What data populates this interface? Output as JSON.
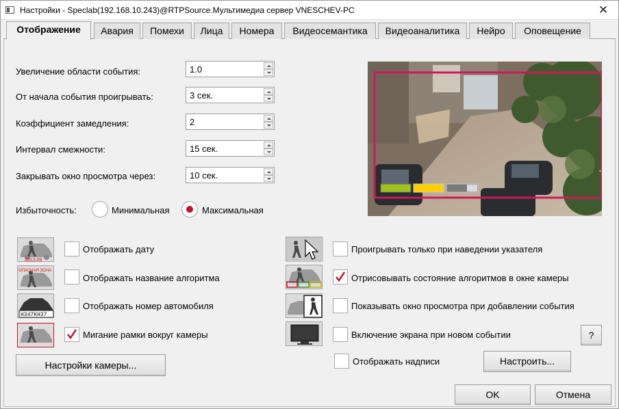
{
  "window": {
    "title": "Настройки - Speclab(192.168.10.243)@RTPSource.Мультимедиа сервер VNESCHEV-PC",
    "close_glyph": "✕"
  },
  "tabs": [
    {
      "label": "Отображение",
      "active": true
    },
    {
      "label": "Авария"
    },
    {
      "label": "Помехи"
    },
    {
      "label": "Лица"
    },
    {
      "label": "Номера"
    },
    {
      "label": "Видеосемантика"
    },
    {
      "label": "Видеоаналитика"
    },
    {
      "label": "Нейро"
    },
    {
      "label": "Оповещение"
    }
  ],
  "fields": [
    {
      "label": "Увеличение области события:",
      "value": "1.0"
    },
    {
      "label": "От начала события проигрывать:",
      "value": "3 сек."
    },
    {
      "label": "Коэффициент замедления:",
      "value": "2"
    },
    {
      "label": "Интервал смежности:",
      "value": "15 сек."
    },
    {
      "label": "Закрывать окно просмотра через:",
      "value": "10 сек."
    }
  ],
  "redundancy": {
    "label": "Избыточность:",
    "options": [
      {
        "label": "Минимальная",
        "selected": false
      },
      {
        "label": "Максимальная",
        "selected": true
      }
    ]
  },
  "left_options": [
    {
      "label": "Отображать дату",
      "checked": false,
      "icon": "date-overlay-icon",
      "icon_text": "2013.09"
    },
    {
      "label": "Отображать название алгоритма",
      "checked": false,
      "icon": "algorithm-name-icon",
      "icon_text": "ОПАСНАЯ ЗОНА"
    },
    {
      "label": "Отображать номер автомобиля",
      "checked": false,
      "icon": "license-plate-icon",
      "icon_text": "Н347КН37"
    },
    {
      "label": "Мигание рамки вокруг камеры",
      "checked": true,
      "icon": "blink-frame-icon"
    }
  ],
  "right_options": [
    {
      "label": "Проигрывать только при наведении указателя",
      "checked": false,
      "icon": "hover-pointer-icon"
    },
    {
      "label": "Отрисовывать состояние алгоритмов в окне камеры",
      "checked": true,
      "icon": "algorithm-state-icon"
    },
    {
      "label": "Показывать окно просмотра при добавлении события",
      "checked": false,
      "icon": "preview-window-icon"
    },
    {
      "label": "Включение экрана при новом событии",
      "checked": false,
      "icon": "monitor-icon"
    }
  ],
  "show_captions": {
    "label": "Отображать надписи",
    "checked": false
  },
  "buttons": {
    "camera_settings": "Настройки камеры...",
    "configure": "Настроить...",
    "help": "?",
    "ok": "OK",
    "cancel": "Отмена"
  },
  "colors": {
    "accent_red": "#c8102e",
    "frame_pink": "#cc1a55",
    "state_green": "#9fc21f",
    "state_yellow": "#ffd000",
    "state_gray": "#7a7a7a"
  }
}
